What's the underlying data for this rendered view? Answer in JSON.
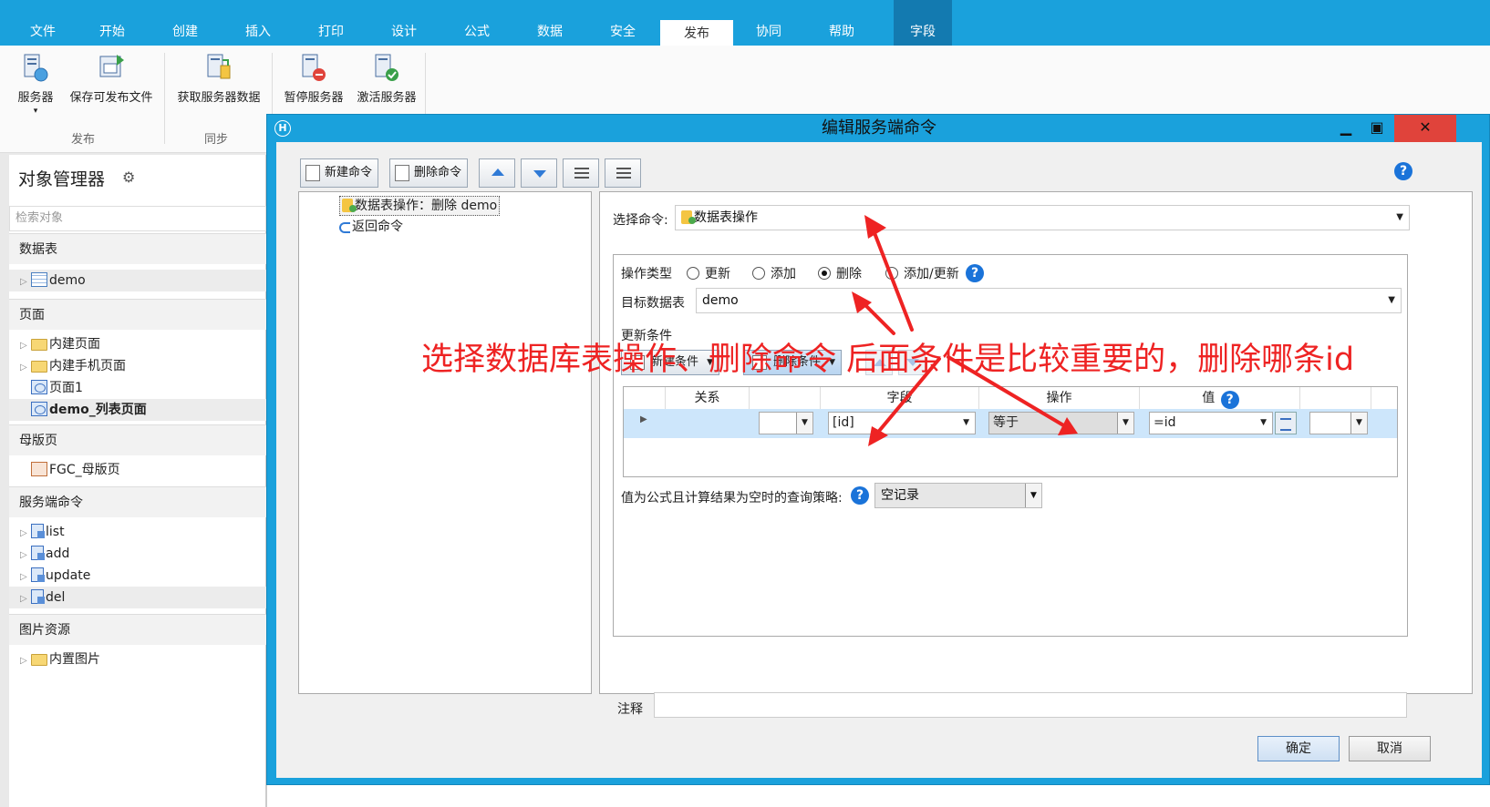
{
  "ribbon": {
    "tabs": [
      "文件",
      "开始",
      "创建",
      "插入",
      "打印",
      "设计",
      "公式",
      "数据",
      "安全",
      "发布",
      "协同",
      "帮助",
      "字段"
    ],
    "active_tab": "发布",
    "buttons": {
      "server": "服务器",
      "save_publish": "保存可发布文件",
      "get_server_data": "获取服务器数据",
      "pause_server": "暂停服务器",
      "activate_server": "激活服务器"
    },
    "groups": {
      "publish": "发布",
      "sync": "同步"
    }
  },
  "object_manager": {
    "title": "对象管理器",
    "search_placeholder": "检索对象",
    "sections": {
      "tables": "数据表",
      "pages": "页面",
      "masters": "母版页",
      "server_commands": "服务端命令",
      "images": "图片资源"
    },
    "items": {
      "demo_table": "demo",
      "builtin_pages": "内建页面",
      "builtin_mobile_pages": "内建手机页面",
      "page1": "页面1",
      "demo_list_page": "demo_列表页面",
      "fgc_master": "FGC_母版页",
      "cmd_list": "list",
      "cmd_add": "add",
      "cmd_update": "update",
      "cmd_del": "del",
      "builtin_images": "内置图片"
    }
  },
  "dialog": {
    "title": "编辑服务端命令",
    "toolbar": {
      "new_command": "新建命令",
      "delete_command": "删除命令"
    },
    "command_tree": {
      "selected": "数据表操作：删除 demo",
      "return": "返回命令"
    },
    "select_command_label": "选择命令:",
    "select_command_value": "数据表操作",
    "op_type_label": "操作类型",
    "op_types": [
      "更新",
      "添加",
      "删除",
      "添加/更新"
    ],
    "op_type_selected": "删除",
    "target_table_label": "目标数据表",
    "target_table_value": "demo",
    "condition_label": "更新条件",
    "new_condition": "新建条件",
    "delete_condition": "删除条件",
    "grid": {
      "headers": {
        "relation": "关系",
        "field": "字段",
        "operation": "操作",
        "value": "值"
      },
      "row": {
        "field": "[id]",
        "operation": "等于",
        "value": "=id"
      }
    },
    "empty_policy_label": "值为公式且计算结果为空时的查询策略:",
    "empty_policy_value": "空记录",
    "notes_label": "注释",
    "ok": "确定",
    "cancel": "取消"
  },
  "annotation": {
    "text": "选择数据库表操作、删除命令 后面条件是比较重要的，删除哪条id",
    "color": "#ee2323"
  },
  "colors": {
    "ribbon_blue": "#1aa1dc",
    "help_blue": "#1a73d9",
    "close_red": "#e0433b",
    "selected_row": "#cde6fb"
  }
}
